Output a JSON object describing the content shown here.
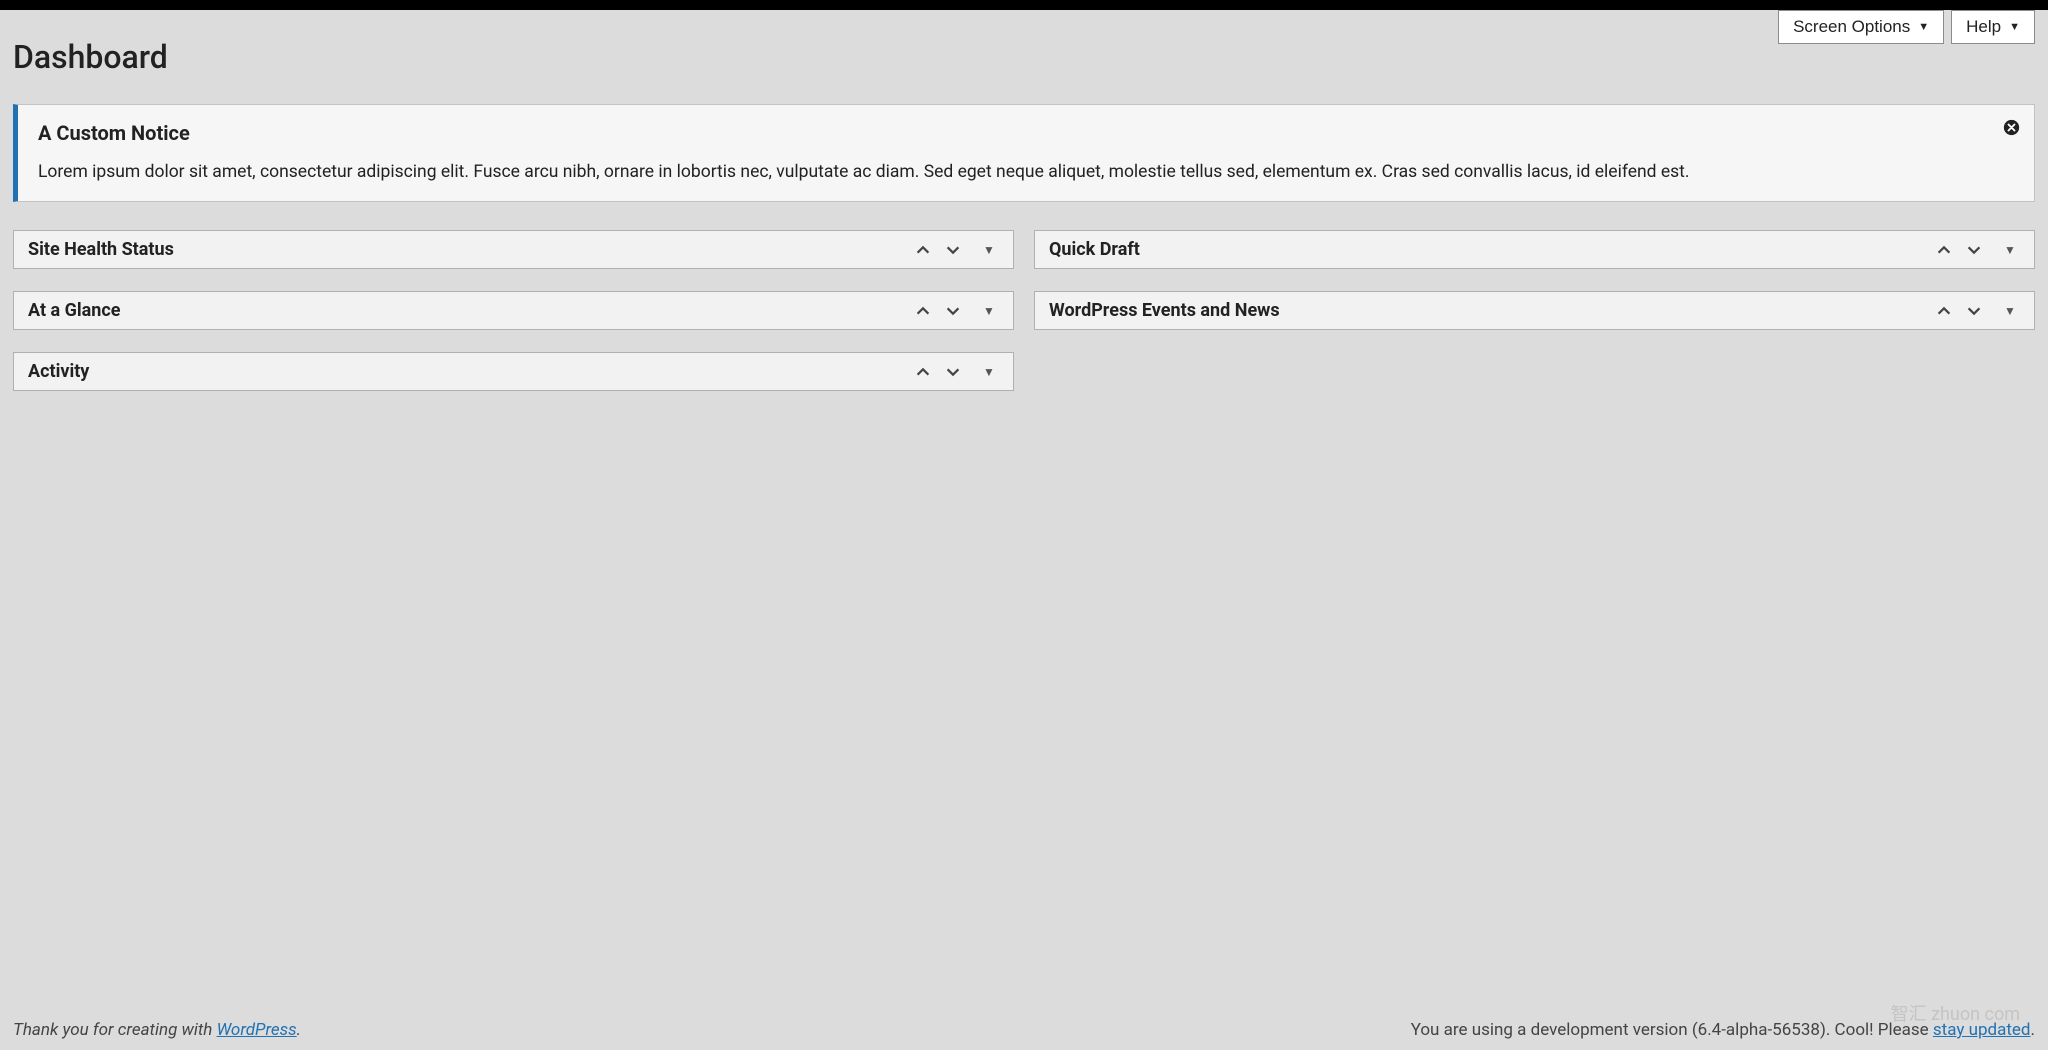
{
  "topButtons": {
    "screenOptions": "Screen Options",
    "help": "Help"
  },
  "pageTitle": "Dashboard",
  "notice": {
    "title": "A Custom Notice",
    "body": "Lorem ipsum dolor sit amet, consectetur adipiscing elit. Fusce arcu nibh, ornare in lobortis nec, vulputate ac diam. Sed eget neque aliquet, molestie tellus sed, elementum ex. Cras sed convallis lacus, id eleifend est."
  },
  "widgets": {
    "left": [
      {
        "title": "Site Health Status"
      },
      {
        "title": "At a Glance"
      },
      {
        "title": "Activity"
      }
    ],
    "right": [
      {
        "title": "Quick Draft"
      },
      {
        "title": "WordPress Events and News"
      }
    ]
  },
  "footer": {
    "thanksPrefix": "Thank you for creating with ",
    "thanksLink": "WordPress",
    "thanksSuffix": ".",
    "versionPrefix": "You are using a development version (6.4-alpha-56538). Cool! Please ",
    "versionLink": "stay updated",
    "versionSuffix": "."
  },
  "watermark": "智汇 zhuon com"
}
